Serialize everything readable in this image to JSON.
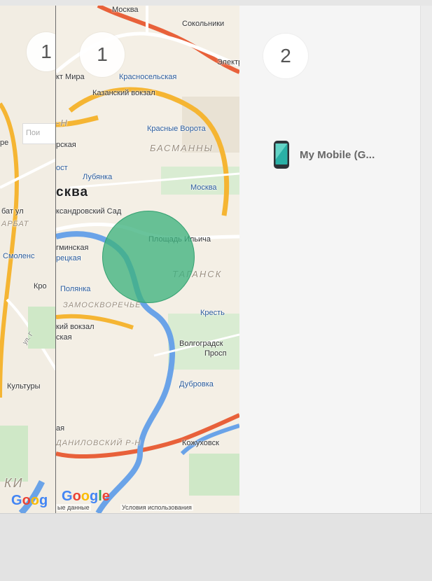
{
  "steps": {
    "left_partial": "1",
    "left": "1",
    "right": "2"
  },
  "device": {
    "name": "My Mobile (G...",
    "icon": "smartphone-icon",
    "accent": "#2ab0a6"
  },
  "map": {
    "labels_main": {
      "moskva_top": "Москва",
      "sokolniki": "Сокольники",
      "electro": "Электр",
      "prospekt_mira": "кт Мира",
      "krasnoselskaya": "Красносельская",
      "kazansky": "Казанский вокзал",
      "h_partial": "-Н",
      "krasnye_vorota": "Красные Ворота",
      "basmanny": "БАСМАННЫ",
      "torgovaya": "рская",
      "kitay": "ост",
      "lubyanka": "Лубянка",
      "moskva_kurs": "Москва",
      "moskva_big": "сква",
      "aleksandrovsky": "ксандровский Сад",
      "ploshad": "Площадь Ильича",
      "taganskiy": "ТАГАНСК",
      "aminskaya": "гминская",
      "tretskaya": "рецкая",
      "polyanka": "Полянка",
      "zamoskvorechye": "ЗАМОСКВОРЕЧЬЕ",
      "krestyan": "Кресть",
      "paveletsky": "кий вокзал",
      "skaya": "ская",
      "volgograd": "Волгоградск",
      "prosp": "Просп",
      "dubrovka": "Дубровка",
      "sh": "ая",
      "danilovsky": "ДАНИЛОВСКИЙ Р-Н",
      "kozhukh": "Кожуховск"
    },
    "labels_left": {
      "re": "ре",
      "batul": "бат ул",
      "arbat": "АРБАТ",
      "smolen": "Смоленс",
      "kro": "Кро",
      "ul": "ул. Г",
      "kultury": "Культуры",
      "ki": "КИ"
    },
    "search_placeholder": "Пои",
    "google_left": [
      "G",
      "o",
      "o",
      "g"
    ],
    "google_main": [
      "G",
      "o",
      "o",
      "g",
      "l",
      "e"
    ],
    "footer_data": "ые данные",
    "footer_terms": "Условия использования",
    "circle_color": "#3fb27f"
  }
}
